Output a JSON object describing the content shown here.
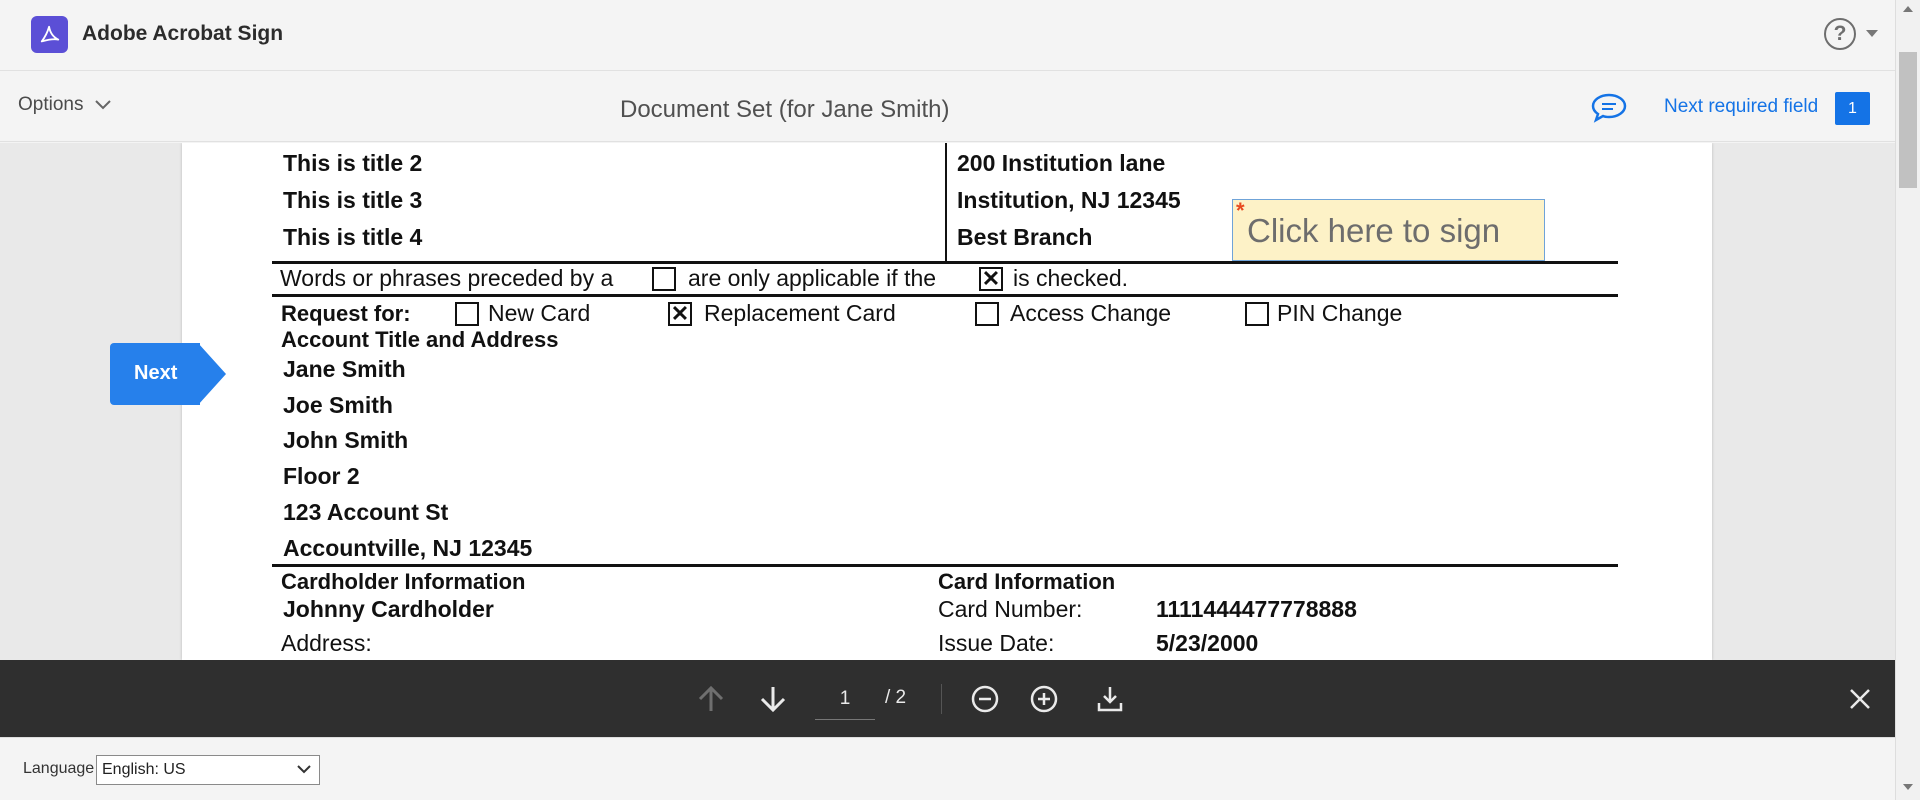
{
  "app": {
    "name": "Adobe Acrobat Sign"
  },
  "toolbar": {
    "options_label": "Options",
    "document_title": "Document Set (for Jane Smith)",
    "next_required_label": "Next required field",
    "required_count": "1"
  },
  "document": {
    "titles": [
      "This is title 2",
      "This is title 3",
      "This is title 4"
    ],
    "address_lines": [
      "200 Institution lane",
      "Institution, NJ 12345",
      "Best Branch"
    ],
    "instruction_prefix": "Words or phrases preceded by a",
    "instruction_middle": "are only applicable if the",
    "instruction_suffix": "is checked.",
    "request_for_label": "Request for:",
    "request_options": [
      {
        "label": "New Card",
        "checked": false
      },
      {
        "label": "Replacement Card",
        "checked": true
      },
      {
        "label": "Access Change",
        "checked": false
      },
      {
        "label": "PIN Change",
        "checked": false
      }
    ],
    "account_heading": "Account Title and Address",
    "account_lines": [
      "Jane Smith",
      "Joe Smith",
      "John Smith",
      "Floor 2",
      "123 Account St",
      "Accountville, NJ 12345"
    ],
    "cardholder_heading": "Cardholder Information",
    "cardholder_name": "Johnny Cardholder",
    "address_label": "Address:",
    "card_heading": "Card Information",
    "card_number_label": "Card Number:",
    "card_number": "1111444477778888",
    "issue_date_label": "Issue Date:",
    "issue_date": "5/23/2000",
    "checkmark_glyph": "✕"
  },
  "sign_field": {
    "label": "Click here to sign",
    "required_marker": "*"
  },
  "next_flag": {
    "label": "Next"
  },
  "nav": {
    "current_page": "1",
    "total_pages": "/ 2"
  },
  "footer": {
    "language_label": "Language",
    "language_value": "English: US"
  },
  "help": {
    "glyph": "?"
  },
  "colors": {
    "accent": "#1473e6",
    "sign_bg": "#fdf2c7",
    "logo": "#5b4fd6",
    "navbar": "#2f2f2f"
  }
}
